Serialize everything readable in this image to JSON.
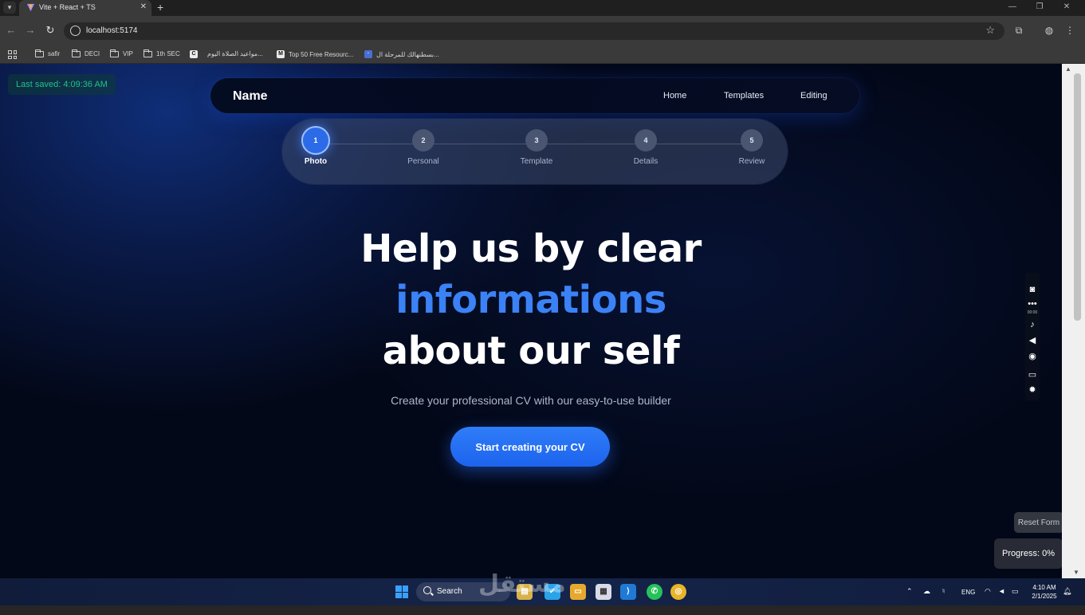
{
  "browser": {
    "tab_title": "Vite + React + TS",
    "tab_close": "✕",
    "new_tab": "+",
    "url": "localhost:5174",
    "win_controls": [
      "—",
      "❐",
      "✕"
    ],
    "bookmarks": [
      {
        "icon": "folder-icon",
        "label": "safir"
      },
      {
        "icon": "folder-icon",
        "label": "DECI"
      },
      {
        "icon": "folder-icon",
        "label": "VIP"
      },
      {
        "icon": "folder-icon",
        "label": "1th SEC"
      },
      {
        "icon": "site-icon",
        "label": ""
      },
      {
        "icon": "none",
        "label": "مواعيد الصلاة اليوم..."
      },
      {
        "icon": "medium-icon",
        "label": "Top 50 Free Resourc..."
      },
      {
        "icon": "site-icon",
        "label": "بسطنهالك للمرحلة ال..."
      }
    ]
  },
  "app": {
    "last_saved": "Last saved: 4:09:36 AM",
    "brand": "Name",
    "nav": [
      "Home",
      "Templates",
      "Editing"
    ],
    "steps": [
      {
        "number": "1",
        "label": "Photo",
        "active": true
      },
      {
        "number": "2",
        "label": "Personal",
        "active": false
      },
      {
        "number": "3",
        "label": "Template",
        "active": false
      },
      {
        "number": "4",
        "label": "Details",
        "active": false
      },
      {
        "number": "5",
        "label": "Review",
        "active": false
      }
    ],
    "hero_line1": "Help us by clear",
    "hero_accent": "informations",
    "hero_line3": "about our self",
    "subtitle": "Create your professional CV with our easy-to-use builder",
    "cta": "Start creating your CV",
    "reset_label": "Reset Form",
    "progress_label": "Progress: 0%",
    "accent_color": "#3b82f6"
  },
  "recorder": {
    "time": "00:00"
  },
  "taskbar": {
    "search_label": "Search",
    "watermark": "مستقل",
    "language": "ENG",
    "time": "4:10 AM",
    "date": "2/1/2025"
  }
}
